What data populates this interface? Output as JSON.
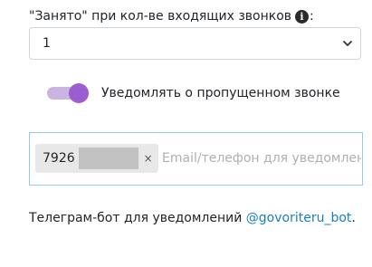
{
  "busy_setting": {
    "label_text": "\"Занято\" при кол-ве входящих звонков",
    "info_icon_glyph": "i",
    "suffix": ":",
    "selected_value": "1"
  },
  "missed_call_toggle": {
    "label": "Уведомлять о пропущенном звонке",
    "checked": true,
    "track_color": "#cbb4e0",
    "knob_color": "#9c5dd0"
  },
  "notify_contacts": {
    "tags": [
      {
        "value": "7926",
        "close_glyph": "×"
      }
    ],
    "input_placeholder": "Email/телефон для уведомления",
    "border_color": "#8fcde6"
  },
  "telegram": {
    "text": "Телеграм-бот для уведомлений",
    "link_text": "@govoriteru_bot",
    "trailing": ".",
    "link_color": "#1a80c0"
  },
  "icons": {
    "info": "info-icon",
    "select_chevron": "chevron-down-icon",
    "tag_close": "close-icon"
  }
}
